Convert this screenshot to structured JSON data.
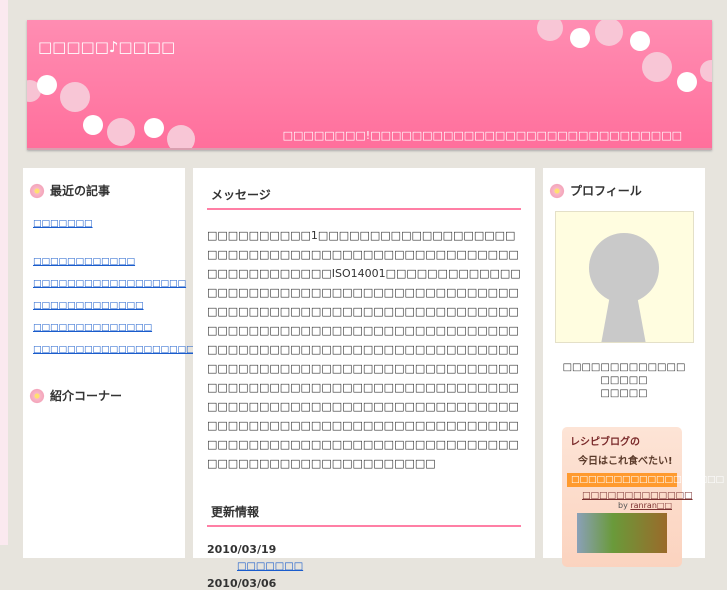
{
  "header": {
    "title": "□□□□□♪□□□□",
    "tagline": "□□□□□□□□!□□□□□□□□□□□□□□□□□□□□□□□□□□□□□□"
  },
  "left": {
    "recent_heading": "最近の記事",
    "recent_links": [
      "□□□□□□□",
      "□□□□□□□□□□□□",
      "□□□□□□□□□□□□□□□□□□",
      "□□□□□□□□□□□□□",
      "□□□□□□□□□□□□□□",
      "□□□□□□□□□□□□□□□□□□□□"
    ],
    "intro_heading": "紹介コーナー"
  },
  "main": {
    "message_heading": "メッセージ",
    "message": "□□□□□□□□□□1□□□□□□□□□□□□□□□□□□□□□□□□□□□□□□□□□□□□□□□□□□□□□□□□□□□□□□□□□□□□□ISO14001□□□□□□□□□□□□□□□□□□□□□□□□□□□□□□□□□□□□□□□□□□□□□□□□□□□□□□□□□□□□□□□□□□□□□□□□□□□□□□□□□□□□□□□□□□□□□□□□□□□□□□□□□□□□□□□□□□□□□□□□□□□□□□□□□□□□□□□□□□□□□□□□□□□□□□□□□□□□□□□□□□□□□□□□□□□□□□□□□□□□□□□□□□□□□□□□□□□□□□□□□□□□□□□□□□□□□□□□□□□□□□□□□□□□□□□□□□□□□□□□□□□□□□□□□□□□□□□□□□□□□□□□□□□□□□□□□□□□□□□□□□□□□□□□□□□□□□□□□□□□□□□□□",
    "updates_heading": "更新情報",
    "updates": [
      {
        "date": "2010/03/19",
        "link": "□□□□□□□"
      },
      {
        "date": "2010/03/06"
      }
    ]
  },
  "right": {
    "profile_heading": "プロフィール",
    "profile_lines": [
      "□□□□□□□□□□□□□",
      "□□□□□",
      "□□□□□"
    ],
    "recipe": {
      "logo": "レシピブログの",
      "subtitle": "今日はこれ食べたい!",
      "bar": "□□□□□□□□□□□□□□□□□□",
      "title": "□□□□□□□□□□□□□",
      "by": "by",
      "author": "ranran□□"
    }
  }
}
